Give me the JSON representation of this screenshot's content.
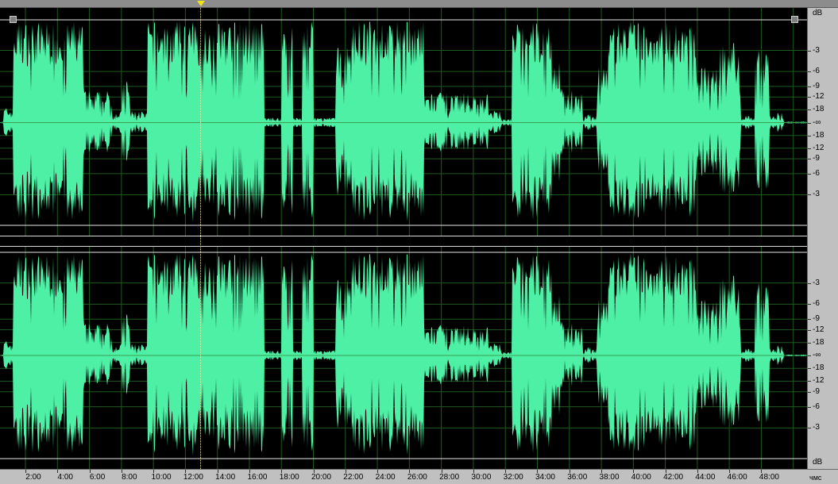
{
  "colors": {
    "waveform": "#4ef0a6",
    "background": "#000000",
    "grid": "#1f5a1f",
    "centerline": "#3aa050",
    "playhead": "#f2e01a"
  },
  "icons": {
    "playhead_marker": "yellow-triangle",
    "scroll_handles": "gray-square"
  },
  "db_ruler": {
    "unit": "dB",
    "channel1_labels": [
      "-3",
      "-6",
      "-9",
      "-12",
      "-18",
      "-∞",
      "-18",
      "-12",
      "-9",
      "-6",
      "-3"
    ],
    "channel2_labels": [
      "-3",
      "-6",
      "-9",
      "-12",
      "-18",
      "-∞",
      "-18",
      "-12",
      "-9",
      "-6",
      "-3"
    ]
  },
  "time_ruler": {
    "labels": [
      "2:00",
      "4:00",
      "6:00",
      "8:00",
      "10:00",
      "12:00",
      "14:00",
      "16:00",
      "18:00",
      "20:00",
      "22:00",
      "24:00",
      "26:00",
      "28:00",
      "30:00",
      "32:00",
      "34:00",
      "36:00",
      "38:00",
      "40:00",
      "42:00",
      "44:00",
      "46:00",
      "48:00"
    ],
    "unit": "чмс"
  },
  "playhead": {
    "time": "12:40"
  },
  "waveform": {
    "duration_min": 49.5,
    "segments": [
      [
        0.2,
        0.8,
        0.15
      ],
      [
        0.8,
        2.4,
        0.98
      ],
      [
        2.4,
        5.3,
        0.97
      ],
      [
        5.3,
        7.0,
        0.32
      ],
      [
        7.0,
        7.6,
        0.12
      ],
      [
        7.6,
        8.1,
        0.45
      ],
      [
        8.1,
        9.2,
        0.12
      ],
      [
        9.2,
        11.6,
        0.97
      ],
      [
        11.6,
        16.5,
        0.98
      ],
      [
        16.5,
        17.6,
        0.05
      ],
      [
        17.6,
        18.3,
        0.99
      ],
      [
        18.3,
        18.9,
        0.05
      ],
      [
        18.9,
        19.6,
        0.95
      ],
      [
        19.6,
        21.0,
        0.05
      ],
      [
        21.0,
        21.8,
        0.75
      ],
      [
        21.8,
        26.5,
        0.98
      ],
      [
        26.5,
        30.5,
        0.3
      ],
      [
        30.5,
        31.3,
        0.12
      ],
      [
        31.3,
        32.0,
        0.04
      ],
      [
        32.0,
        33.0,
        0.98
      ],
      [
        33.0,
        34.5,
        0.97
      ],
      [
        34.5,
        35.0,
        0.6
      ],
      [
        35.0,
        36.4,
        0.35
      ],
      [
        36.4,
        37.3,
        0.08
      ],
      [
        37.3,
        38.0,
        0.55
      ],
      [
        38.0,
        39.6,
        0.98
      ],
      [
        39.6,
        43.5,
        0.97
      ],
      [
        43.5,
        45.0,
        0.55
      ],
      [
        45.0,
        46.3,
        0.8
      ],
      [
        46.3,
        47.2,
        0.08
      ],
      [
        47.2,
        48.1,
        0.72
      ],
      [
        48.1,
        49.0,
        0.1
      ]
    ]
  }
}
